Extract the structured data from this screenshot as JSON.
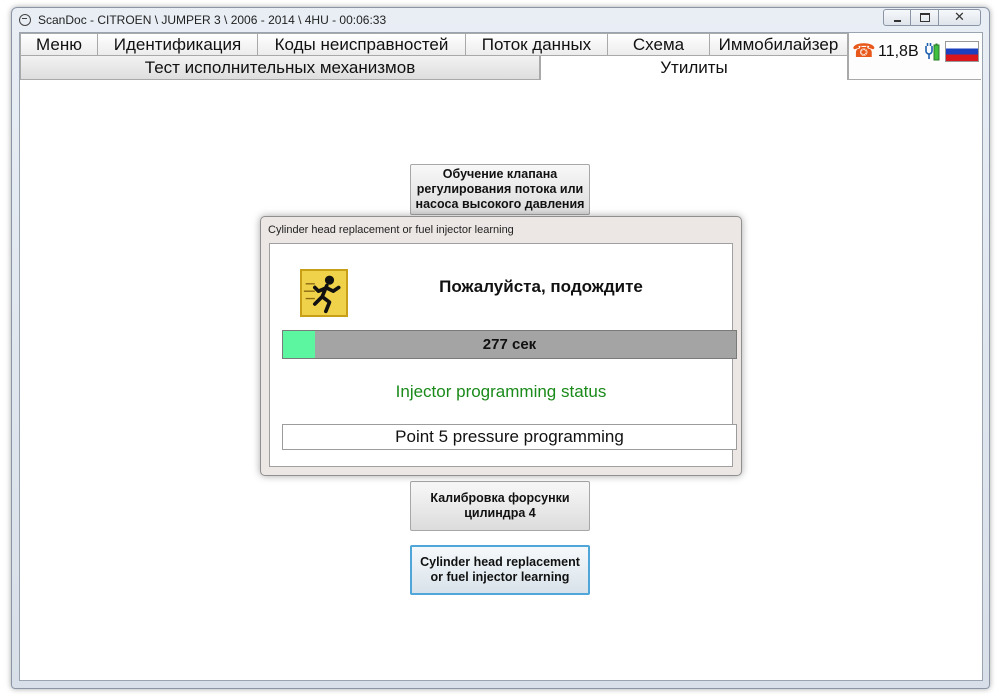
{
  "window": {
    "title": "ScanDoc - CITROEN \\ JUMPER 3 \\ 2006 - 2014 \\ 4HU - 00:06:33"
  },
  "tabs_primary": [
    {
      "label": "Меню"
    },
    {
      "label": "Идентификация"
    },
    {
      "label": "Коды неисправностей"
    },
    {
      "label": "Поток данных"
    },
    {
      "label": "Схема"
    },
    {
      "label": "Иммобилайзер"
    }
  ],
  "tabs_secondary": [
    {
      "label": "Тест исполнительных механизмов",
      "active": false
    },
    {
      "label": "Утилиты",
      "active": true
    }
  ],
  "status": {
    "voltage": "11,8В",
    "icons": [
      "phone-icon",
      "plug-battery-icon",
      "russia-flag-icon"
    ],
    "accent_color": "#e8581a"
  },
  "utility_buttons": [
    {
      "label": "Обучение клапана регулирования потока или насоса высокого давления"
    },
    {
      "label": "Калибровка форсунки цилиндра 4"
    },
    {
      "label": "Cylinder head replacement or fuel injector learning",
      "focused": true
    }
  ],
  "dialog": {
    "title": "Cylinder head replacement or fuel injector learning",
    "icon": "running-man-icon",
    "message": "Пожалуйста, подождите",
    "progress_text": "277 сек",
    "progress_fraction": 0.07,
    "status_label": "Injector programming status",
    "status_color": "#1a8a1a",
    "step_text": "Point 5 pressure programming"
  }
}
